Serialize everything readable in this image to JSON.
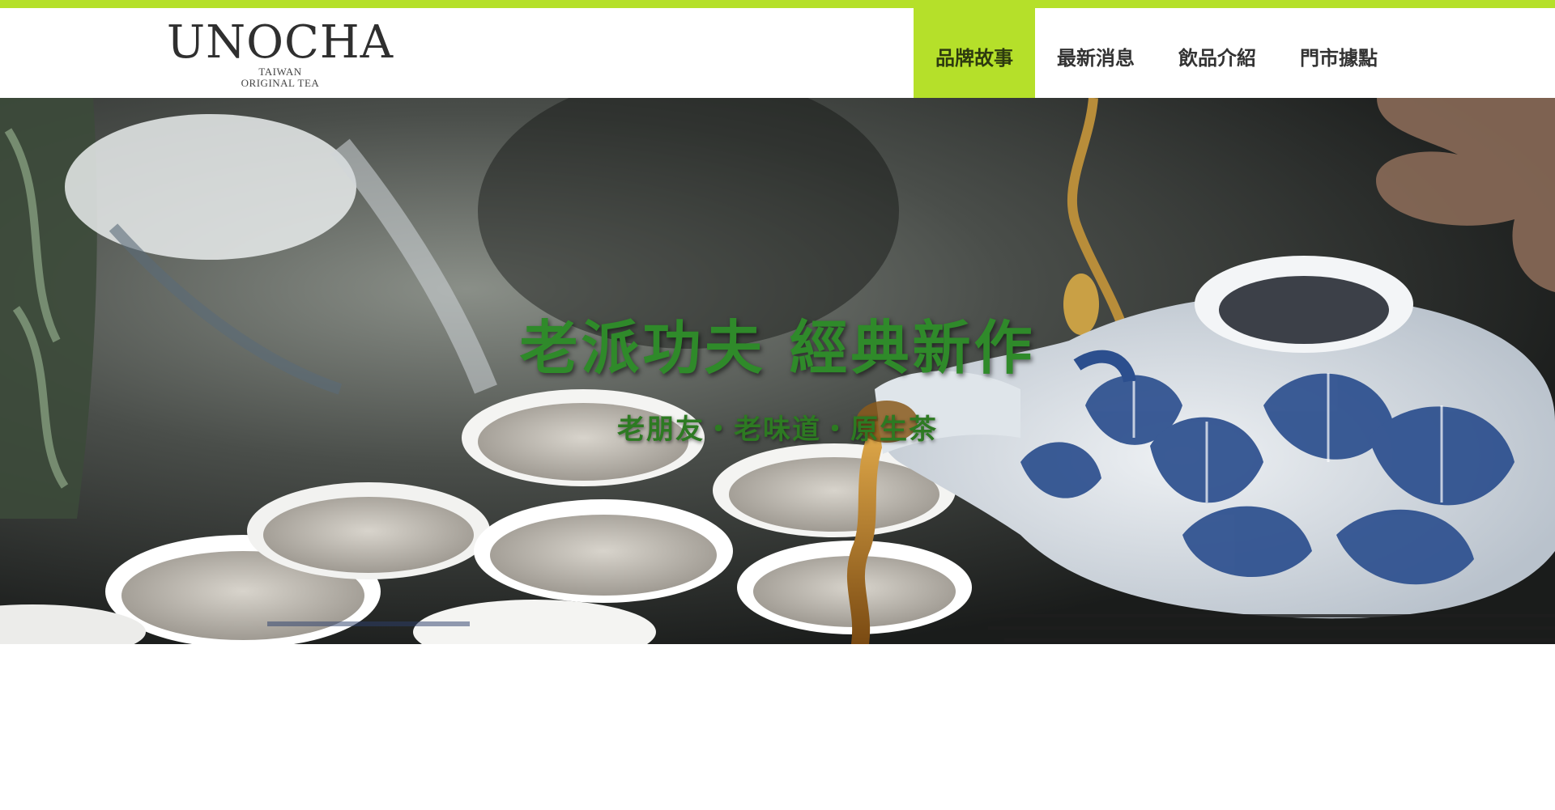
{
  "brand": {
    "name": "UNOCHA",
    "tagline_line1": "TAIWAN",
    "tagline_line2": "ORIGINAL TEA"
  },
  "nav": {
    "items": [
      {
        "label": "品牌故事",
        "active": true
      },
      {
        "label": "最新消息",
        "active": false
      },
      {
        "label": "飲品介紹",
        "active": false
      },
      {
        "label": "門市據點",
        "active": false
      }
    ]
  },
  "hero": {
    "title": "老派功夫 經典新作",
    "subtitle": "老朋友・老味道・原生茶",
    "image_subject": "blue-and-white-teapot-pouring-tea-into-cups"
  },
  "colors": {
    "accent": "#b5e02a",
    "headline_green": "#2f8a2a",
    "nav_text": "#333333"
  }
}
